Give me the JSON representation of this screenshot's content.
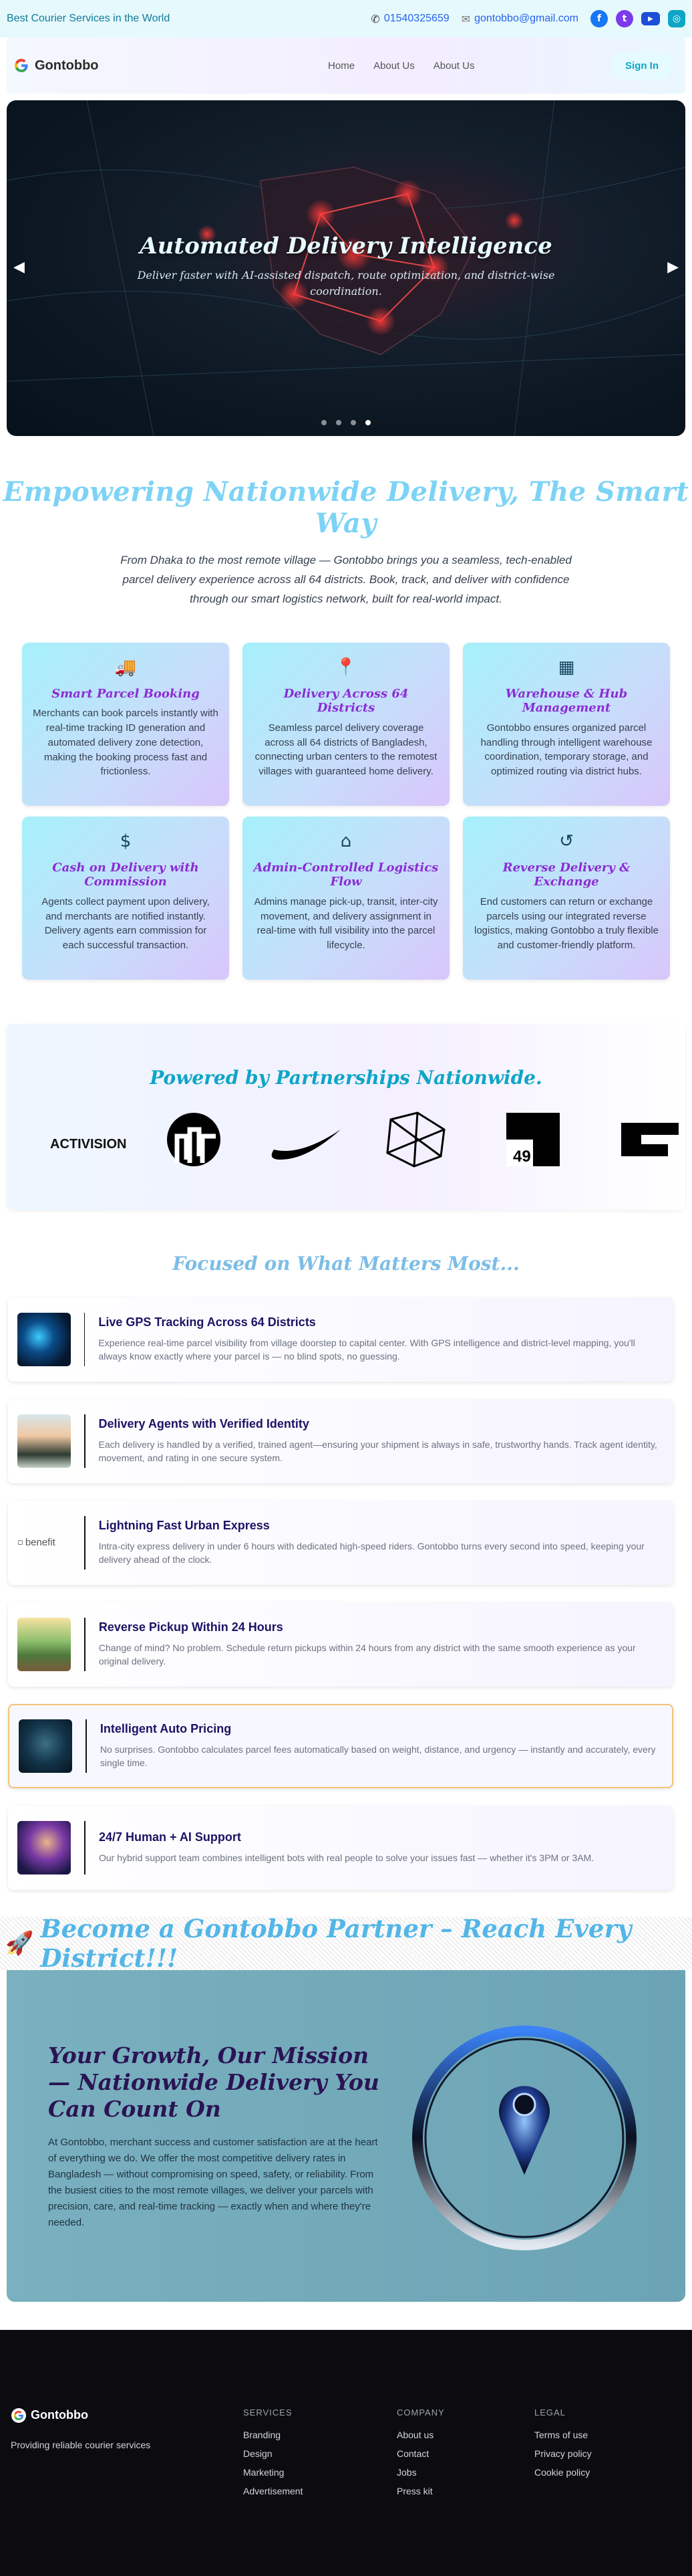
{
  "topbar": {
    "tagline": "Best Courier Services in the World",
    "phone": "01540325659",
    "email": "gontobbo@gmail.com",
    "social": [
      "facebook-icon",
      "twitter-icon",
      "youtube-icon",
      "instagram-icon"
    ],
    "social_colors": [
      "#1877f2",
      "#7c3aed",
      "#1d4ed8",
      "#0ea5c6"
    ]
  },
  "nav": {
    "brand": "Gontobbo",
    "links": [
      "Home",
      "About Us",
      "About Us"
    ],
    "signin": "Sign In"
  },
  "hero": {
    "title": "Automated Delivery Intelligence",
    "subtitle": "Deliver faster with AI-assisted dispatch, route optimization, and district-wise coordination.",
    "slide_count": 4,
    "active_slide": 4
  },
  "intro": {
    "title": "Empowering Nationwide Delivery, The Smart Way",
    "text": "From Dhaka to the most remote village — Gontobbo brings you a seamless, tech-enabled parcel delivery experience across all 64 districts. Book, track, and deliver with confidence through our smart logistics network, built for real-world impact."
  },
  "features": [
    {
      "icon": "truck-icon",
      "glyph": "🚚",
      "title": "Smart Parcel Booking",
      "text": "Merchants can book parcels instantly with real-time tracking ID generation and automated delivery zone detection, making the booking process fast and frictionless."
    },
    {
      "icon": "map-pin-icon",
      "glyph": "📍",
      "title": "Delivery Across 64 Districts",
      "text": "Seamless parcel delivery coverage across all 64 districts of Bangladesh, connecting urban centers to the remotest villages with guaranteed home delivery."
    },
    {
      "icon": "boxes-icon",
      "glyph": "▦",
      "title": "Warehouse & Hub Management",
      "text": "Gontobbo ensures organized parcel handling through intelligent warehouse coordination, temporary storage, and optimized routing via district hubs."
    },
    {
      "icon": "hand-dollar-icon",
      "glyph": "$",
      "title": "Cash on Delivery with Commission",
      "text": "Agents collect payment upon delivery, and merchants are notified instantly. Delivery agents earn commission for each successful transaction."
    },
    {
      "icon": "warehouse-icon",
      "glyph": "⌂",
      "title": "Admin-Controlled Logistics Flow",
      "text": "Admins manage pick-up, transit, inter-city movement, and delivery assignment in real-time with full visibility into the parcel lifecycle."
    },
    {
      "icon": "rotate-icon",
      "glyph": "↺",
      "title": "Reverse Delivery & Exchange",
      "text": "End customers can return or exchange parcels using our integrated reverse logistics, making Gontobbo a truly flexible and customer-friendly platform."
    }
  ],
  "partners": {
    "title": "Powered by Partnerships Nationwide.",
    "logo_text": "ACTIVISION",
    "logo_num": "49"
  },
  "focus": {
    "title": "Focused on What Matters Most...",
    "items": [
      {
        "title": "Live GPS Tracking Across 64 Districts",
        "text": "Experience real-time parcel visibility from village doorstep to capital center. With GPS intelligence and district-level mapping, you'll always know exactly where your parcel is — no blind spots, no guessing."
      },
      {
        "title": "Delivery Agents with Verified Identity",
        "text": "Each delivery is handled by a verified, trained agent—ensuring your shipment is always in safe, trustworthy hands. Track agent identity, movement, and rating in one secure system."
      },
      {
        "title": "Lightning Fast Urban Express",
        "text": "Intra-city express delivery in under 6 hours with dedicated high-speed riders. Gontobbo turns every second into speed, keeping your delivery ahead of the clock.",
        "broken_alt": "benefit"
      },
      {
        "title": "Reverse Pickup Within 24 Hours",
        "text": "Change of mind? No problem. Schedule return pickups within 24 hours from any district with the same smooth experience as your original delivery."
      },
      {
        "title": "Intelligent Auto Pricing",
        "text": "No surprises. Gontobbo calculates parcel fees automatically based on weight, distance, and urgency — instantly and accurately, every single time."
      },
      {
        "title": "24/7 Human + AI Support",
        "text": "Our hybrid support team combines intelligent bots with real people to solve your issues fast — whether it's 3PM or 3AM."
      }
    ]
  },
  "cta": {
    "heading": "Become a Gontobbo Partner – Reach Every District!!!",
    "title": "Your Growth, Our Mission — Nationwide Delivery You Can Count On",
    "text": "At Gontobbo, merchant success and customer satisfaction are at the heart of everything we do. We offer the most competitive delivery rates in Bangladesh — without compromising on speed, safety, or reliability. From the busiest cities to the most remote villages, we deliver your parcels with precision, care, and real-time tracking — exactly when and where they're needed."
  },
  "footer": {
    "brand": "Gontobbo",
    "tagline": "Providing reliable courier services",
    "columns": [
      {
        "title": "SERVICES",
        "links": [
          "Branding",
          "Design",
          "Marketing",
          "Advertisement"
        ]
      },
      {
        "title": "COMPANY",
        "links": [
          "About us",
          "Contact",
          "Jobs",
          "Press kit"
        ]
      },
      {
        "title": "LEGAL",
        "links": [
          "Terms of use",
          "Privacy policy",
          "Cookie policy"
        ]
      }
    ]
  }
}
